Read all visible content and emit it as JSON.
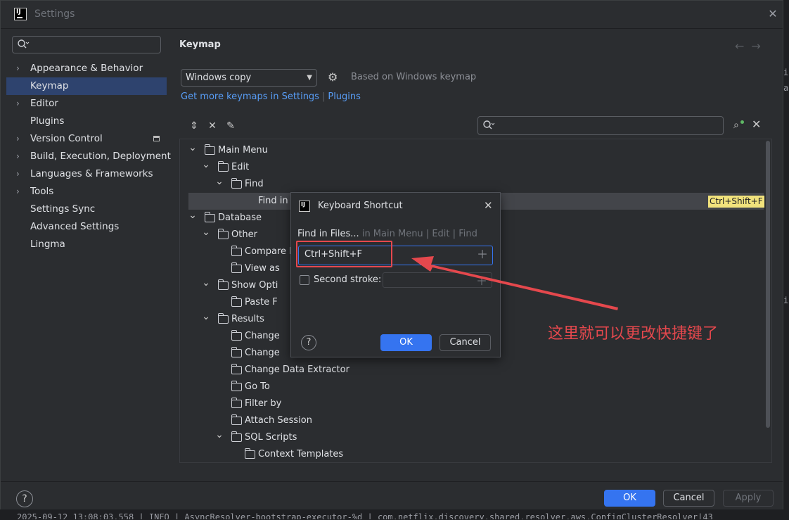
{
  "window": {
    "title": "Settings",
    "app_icon_text": "IJ"
  },
  "sidebar": {
    "search_placeholder": "",
    "items": [
      {
        "label": "Appearance & Behavior",
        "expandable": true
      },
      {
        "label": "Keymap",
        "selected": true
      },
      {
        "label": "Editor",
        "expandable": true
      },
      {
        "label": "Plugins"
      },
      {
        "label": "Version Control",
        "expandable": true
      },
      {
        "label": "Build, Execution, Deployment",
        "expandable": true
      },
      {
        "label": "Languages & Frameworks",
        "expandable": true
      },
      {
        "label": "Tools",
        "expandable": true
      },
      {
        "label": "Settings Sync"
      },
      {
        "label": "Advanced Settings"
      },
      {
        "label": "Lingma"
      }
    ]
  },
  "main": {
    "title": "Keymap",
    "keymap_select": "Windows copy",
    "based_on": "Based on Windows keymap",
    "link_text": "Get more keymaps in Settings",
    "link_plugins": "Plugins",
    "tree": [
      {
        "label": "Main Menu",
        "level": 0,
        "type": "folder",
        "expanded": true
      },
      {
        "label": "Edit",
        "level": 1,
        "type": "folder",
        "expanded": true
      },
      {
        "label": "Find",
        "level": 2,
        "type": "folder",
        "expanded": true
      },
      {
        "label": "Find in",
        "level": 3,
        "type": "action",
        "selected": true,
        "shortcut": "Ctrl+Shift+F"
      },
      {
        "label": "Database",
        "level": 0,
        "type": "folder",
        "expanded": true
      },
      {
        "label": "Other",
        "level": 1,
        "type": "folder",
        "expanded": true
      },
      {
        "label": "Compare D",
        "level": 2,
        "type": "folder"
      },
      {
        "label": "View as",
        "level": 2,
        "type": "folder"
      },
      {
        "label": "Show Opti",
        "level": 1,
        "type": "folder",
        "expanded": true
      },
      {
        "label": "Paste F",
        "level": 2,
        "type": "folder"
      },
      {
        "label": "Results",
        "level": 1,
        "type": "folder",
        "expanded": true
      },
      {
        "label": "Change",
        "level": 2,
        "type": "folder"
      },
      {
        "label": "Change",
        "level": 2,
        "type": "folder"
      },
      {
        "label": "Change Data Extractor",
        "level": 2,
        "type": "folder"
      },
      {
        "label": "Go To",
        "level": 2,
        "type": "folder"
      },
      {
        "label": "Filter by",
        "level": 2,
        "type": "folder"
      },
      {
        "label": "Attach Session",
        "level": 2,
        "type": "folder"
      },
      {
        "label": "SQL Scripts",
        "level": 2,
        "type": "folder",
        "expanded": true
      },
      {
        "label": "Context Templates",
        "level": 3,
        "type": "folder"
      }
    ]
  },
  "dialog": {
    "title": "Keyboard Shortcut",
    "action_name": "Find in Files...",
    "path_in": "in Main Menu",
    "path_sep": "|",
    "path_edit": "Edit",
    "path_find": "Find",
    "first_stroke": "Ctrl+Shift+F",
    "second_stroke_label": "Second stroke:",
    "ok": "OK",
    "cancel": "Cancel",
    "help": "?"
  },
  "footer": {
    "ok": "OK",
    "cancel": "Cancel",
    "apply": "Apply",
    "help": "?"
  },
  "annotation": {
    "text": "这里就可以更改快捷键了",
    "color": "#e5484d"
  },
  "background_log": "2025-09-12 13:08:03.558 | INFO | AsyncResolver-bootstrap-executor-%d | com.netflix.discovery.shared.resolver.aws.ConfigClusterResolver|43",
  "colors": {
    "accent": "#3574f0",
    "selection": "#2e436e",
    "shortcut_badge": "#f1e27c",
    "annotation": "#e5484d"
  }
}
